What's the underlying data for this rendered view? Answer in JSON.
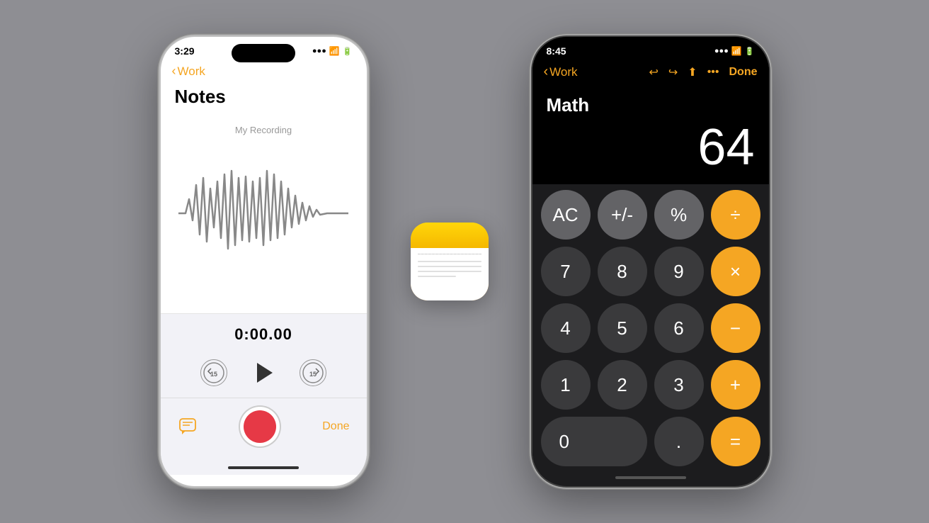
{
  "background": "#8e8e93",
  "left_phone": {
    "status": {
      "time": "3:29",
      "lock": "🔒",
      "signal": "●",
      "wifi": "▲",
      "battery": "▐"
    },
    "nav": {
      "back_label": "Work",
      "chevron": "‹"
    },
    "title": "Notes",
    "recording_label": "My Recording",
    "timer": "0:00.00",
    "controls": {
      "skip_back": "15",
      "skip_fwd": "15"
    },
    "bottom": {
      "done_label": "Done"
    }
  },
  "right_phone": {
    "status": {
      "time": "8:45",
      "lock": "🔒",
      "wifi": "▲",
      "battery": "▐"
    },
    "nav": {
      "back_label": "Work",
      "chevron": "‹",
      "done_label": "Done"
    },
    "calc_title": "Math",
    "display_value": "64",
    "buttons": [
      [
        "AC",
        "+/-",
        "%",
        "÷"
      ],
      [
        "7",
        "8",
        "9",
        "×"
      ],
      [
        "4",
        "5",
        "6",
        "−"
      ],
      [
        "1",
        "2",
        "3",
        "+"
      ],
      [
        "0",
        ".",
        "="
      ]
    ],
    "button_types": [
      [
        "gray",
        "gray",
        "gray",
        "orange"
      ],
      [
        "dark",
        "dark",
        "dark",
        "orange"
      ],
      [
        "dark",
        "dark",
        "dark",
        "orange"
      ],
      [
        "dark",
        "dark",
        "dark",
        "orange"
      ],
      [
        "dark-wide",
        "dark",
        "orange"
      ]
    ]
  },
  "center_icon": {
    "alt": "Notes app icon"
  }
}
